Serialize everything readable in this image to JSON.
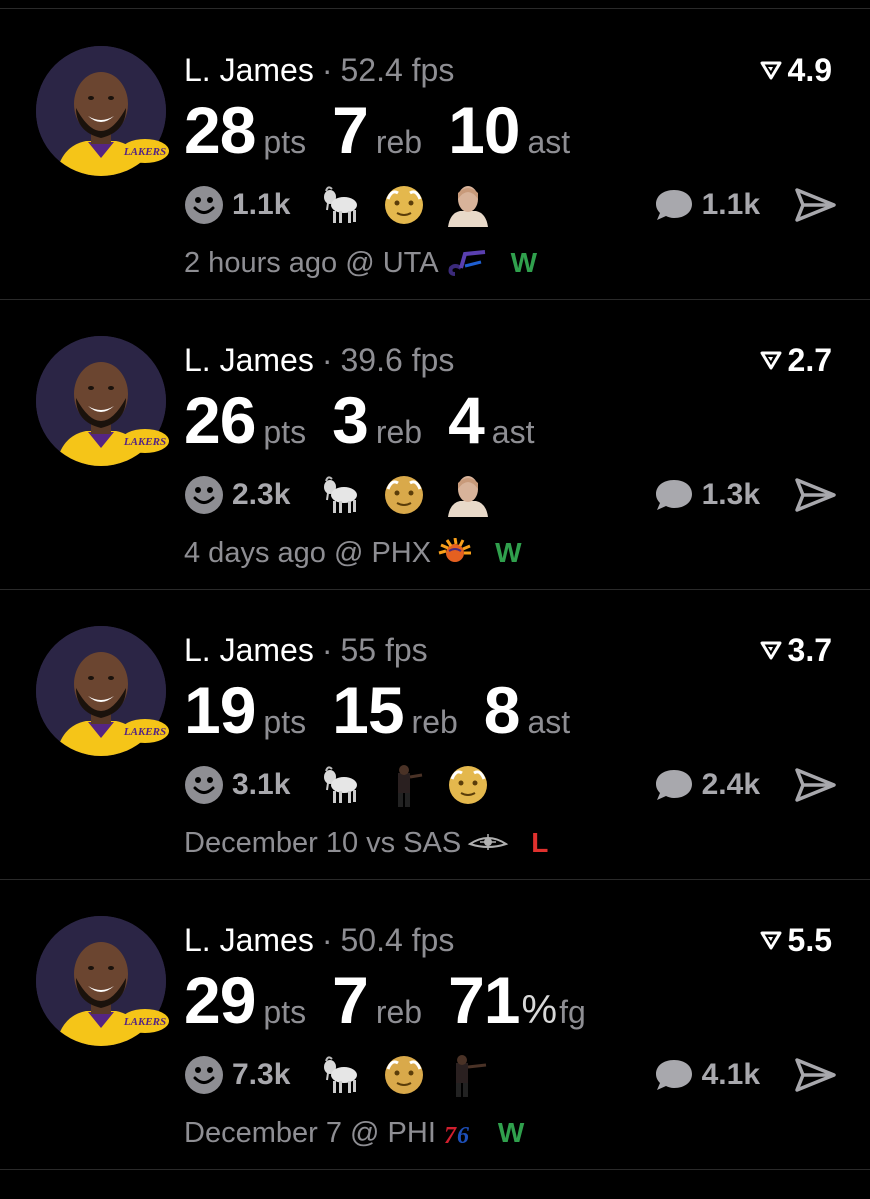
{
  "colors": {
    "background": "#000000",
    "win": "#30a04d",
    "loss": "#e0312e",
    "muted": "#8e8e93"
  },
  "posts": [
    {
      "player": "L. James",
      "separator": "·",
      "fps": "52.4 fps",
      "rating": "4.9",
      "stats": [
        {
          "value": "28",
          "unit": "pts"
        },
        {
          "value": "7",
          "unit": "reb"
        },
        {
          "value": "10",
          "unit": "ast"
        }
      ],
      "reactions_count": "1.1k",
      "reaction_icons": [
        "goat-emoji",
        "old-man-emoji",
        "person-photo-emoji"
      ],
      "comments": "1.1k",
      "when": "2 hours ago",
      "venue": "@ UTA",
      "team_logo": "jazz-logo",
      "result": "W"
    },
    {
      "player": "L. James",
      "separator": "·",
      "fps": "39.6 fps",
      "rating": "2.7",
      "stats": [
        {
          "value": "26",
          "unit": "pts"
        },
        {
          "value": "3",
          "unit": "reb"
        },
        {
          "value": "4",
          "unit": "ast"
        }
      ],
      "reactions_count": "2.3k",
      "reaction_icons": [
        "goat-emoji",
        "old-man-emoji",
        "person-photo-emoji"
      ],
      "comments": "1.3k",
      "when": "4 days ago",
      "venue": "@ PHX",
      "team_logo": "suns-logo",
      "result": "W"
    },
    {
      "player": "L. James",
      "separator": "·",
      "fps": "55 fps",
      "rating": "3.7",
      "stats": [
        {
          "value": "19",
          "unit": "pts"
        },
        {
          "value": "15",
          "unit": "reb"
        },
        {
          "value": "8",
          "unit": "ast"
        }
      ],
      "reactions_count": "3.1k",
      "reaction_icons": [
        "goat-emoji",
        "player-photo-emoji",
        "old-man-emoji"
      ],
      "comments": "2.4k",
      "when": "December 10",
      "venue": "vs SAS",
      "team_logo": "spurs-logo",
      "result": "L"
    },
    {
      "player": "L. James",
      "separator": "·",
      "fps": "50.4 fps",
      "rating": "5.5",
      "stats": [
        {
          "value": "29",
          "unit": "pts"
        },
        {
          "value": "7",
          "unit": "reb"
        },
        {
          "value": "71",
          "unit": "%",
          "unit2": "fg"
        }
      ],
      "reactions_count": "7.3k",
      "reaction_icons": [
        "goat-emoji",
        "old-man-emoji",
        "player-photo-emoji"
      ],
      "comments": "4.1k",
      "when": "December 7",
      "venue": "@ PHI",
      "team_logo": "76ers-logo",
      "result": "W"
    }
  ]
}
